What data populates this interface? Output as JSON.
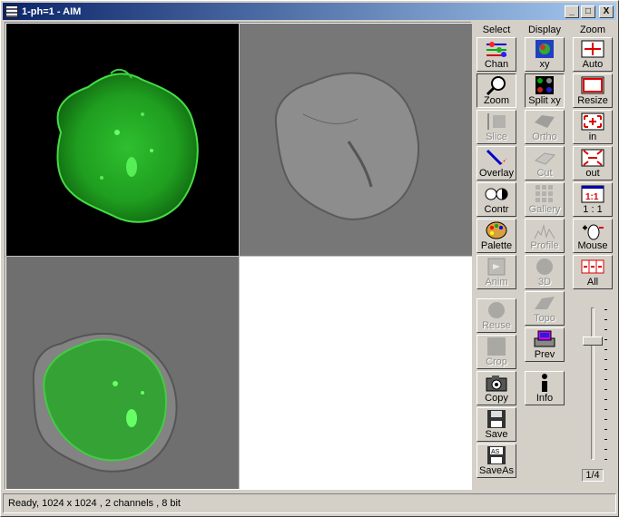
{
  "window": {
    "title": "1-ph=1 - AIM",
    "minimize": "_",
    "maximize": "□",
    "close": "X"
  },
  "toolbar": {
    "select": {
      "header": "Select",
      "buttons": [
        {
          "label": "Chan",
          "icon": "channel-icon",
          "enabled": true,
          "pressed": false
        },
        {
          "label": "Zoom",
          "icon": "magnifier-icon",
          "enabled": true,
          "pressed": true
        },
        {
          "label": "Slice",
          "icon": "slice-icon",
          "enabled": false,
          "pressed": false
        },
        {
          "label": "Overlay",
          "icon": "overlay-pen-icon",
          "enabled": true,
          "pressed": false
        },
        {
          "label": "Contr",
          "icon": "contrast-icon",
          "enabled": true,
          "pressed": false
        },
        {
          "label": "Palette",
          "icon": "palette-icon",
          "enabled": true,
          "pressed": false
        },
        {
          "label": "Anim",
          "icon": "animation-icon",
          "enabled": false,
          "pressed": false
        },
        {
          "label": "Reuse",
          "icon": "reuse-icon",
          "enabled": false,
          "pressed": false
        },
        {
          "label": "Crop",
          "icon": "crop-icon",
          "enabled": false,
          "pressed": false
        },
        {
          "label": "Copy",
          "icon": "camera-icon",
          "enabled": true,
          "pressed": false
        },
        {
          "label": "Save",
          "icon": "floppy-disk-icon",
          "enabled": true,
          "pressed": false
        },
        {
          "label": "SaveAs",
          "icon": "floppy-disk-as-icon",
          "enabled": true,
          "pressed": false
        }
      ]
    },
    "display": {
      "header": "Display",
      "buttons": [
        {
          "label": "xy",
          "icon": "xy-view-icon",
          "enabled": true,
          "pressed": false
        },
        {
          "label": "Split xy",
          "icon": "split-xy-icon",
          "enabled": true,
          "pressed": true
        },
        {
          "label": "Ortho",
          "icon": "ortho-icon",
          "enabled": false,
          "pressed": false
        },
        {
          "label": "Cut",
          "icon": "cut-icon",
          "enabled": false,
          "pressed": false
        },
        {
          "label": "Gallery",
          "icon": "gallery-grid-icon",
          "enabled": false,
          "pressed": false
        },
        {
          "label": "Profile",
          "icon": "profile-icon",
          "enabled": false,
          "pressed": false
        },
        {
          "label": "3D",
          "icon": "3d-sphere-icon",
          "enabled": false,
          "pressed": false
        },
        {
          "label": "Topo",
          "icon": "topo-icon",
          "enabled": false,
          "pressed": false
        },
        {
          "label": "Prev",
          "icon": "printer-preview-icon",
          "enabled": true,
          "pressed": false
        },
        {
          "label": "Info",
          "icon": "info-icon",
          "enabled": true,
          "pressed": false
        }
      ]
    },
    "zoom": {
      "header": "Zoom",
      "buttons": [
        {
          "label": "Auto",
          "icon": "zoom-auto-icon",
          "enabled": true,
          "pressed": false
        },
        {
          "label": "Resize",
          "icon": "resize-icon",
          "enabled": true,
          "pressed": false
        },
        {
          "label": "in",
          "icon": "zoom-in-icon",
          "enabled": true,
          "pressed": false
        },
        {
          "label": "out",
          "icon": "zoom-out-icon",
          "enabled": true,
          "pressed": false
        },
        {
          "label": "1 : 1",
          "icon": "one-to-one-icon",
          "enabled": true,
          "pressed": false
        },
        {
          "label": "Mouse",
          "icon": "mouse-zoom-icon",
          "enabled": true,
          "pressed": false
        },
        {
          "label": "All",
          "icon": "zoom-all-icon",
          "enabled": true,
          "pressed": false
        }
      ],
      "one_to_one_icon_text": "1:1",
      "slider_level": 0.2,
      "readout": "1/4"
    }
  },
  "status": {
    "text": "Ready, 1024 x 1024 , 2 channels , 8 bit"
  },
  "colors": {
    "fluorescence": "#33cc33",
    "titlebar_start": "#0a246a",
    "titlebar_end": "#a6caf0",
    "face": "#d4d0c8"
  }
}
